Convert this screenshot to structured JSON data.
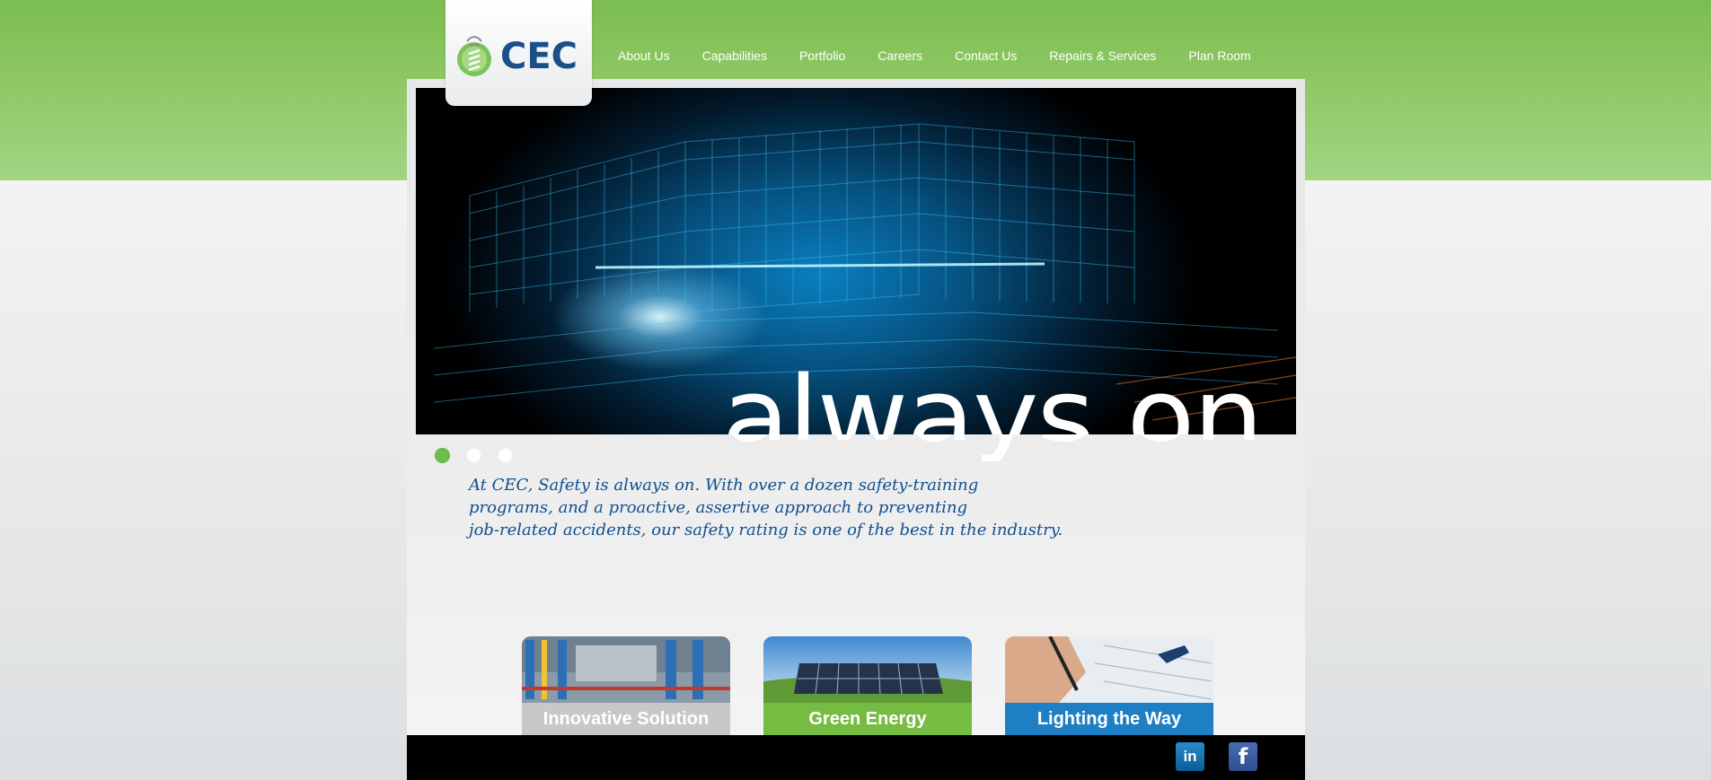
{
  "brand": {
    "logo_text": "CEC",
    "primary_color": "#1b4f8a",
    "accent_green": "#6bbf4a"
  },
  "nav": {
    "items": [
      {
        "label": "About Us"
      },
      {
        "label": "Capabilities"
      },
      {
        "label": "Portfolio"
      },
      {
        "label": "Careers"
      },
      {
        "label": "Contact Us"
      },
      {
        "label": "Repairs & Services"
      },
      {
        "label": "Plan Room"
      }
    ]
  },
  "hero": {
    "headline": "always on",
    "slide_count": 3,
    "active_slide": 1
  },
  "blurb": {
    "lines": [
      "At CEC, Safety is always on. With over a dozen safety-training",
      "programs, and a proactive, assertive approach to preventing",
      "job-related accidents, our safety rating is one of the best in the industry."
    ]
  },
  "cards": [
    {
      "label": "Innovative Solution",
      "color": "#c6c8ca"
    },
    {
      "label": "Green Energy",
      "color": "#76bc43"
    },
    {
      "label": "Lighting the Way",
      "color": "#1f7fc4"
    }
  ],
  "footer": {
    "social": [
      {
        "icon": "linkedin-icon",
        "glyph": "in"
      },
      {
        "icon": "facebook-icon",
        "glyph": "f"
      }
    ]
  }
}
